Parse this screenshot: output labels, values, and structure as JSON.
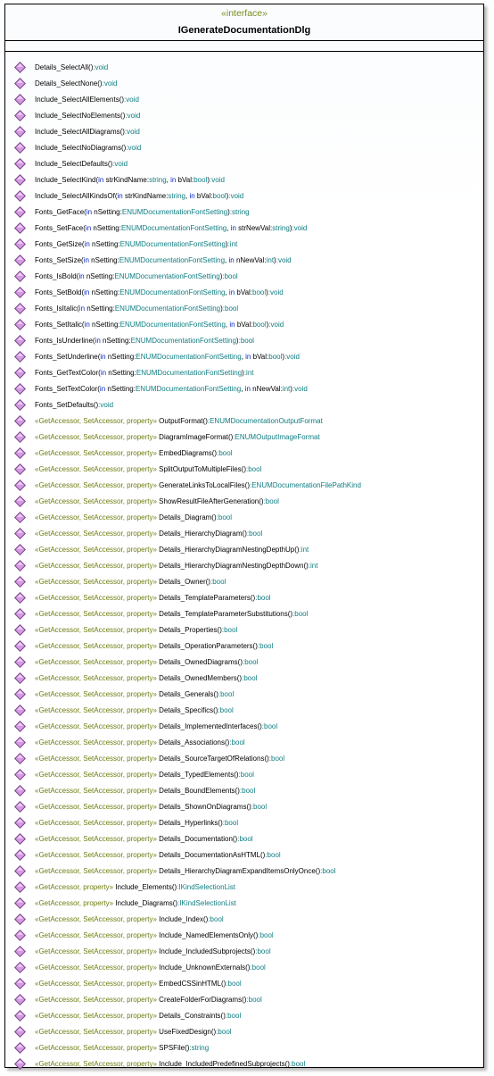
{
  "header": {
    "stereotype": "«interface»",
    "name": "IGenerateDocumentationDlg"
  },
  "colors": {
    "stereotype": "#707c10",
    "keyword": "#0b27c0",
    "type": "#0f7d82",
    "icon_fill": "#d39be0",
    "icon_stroke": "#7a3f8c"
  },
  "icon_name": "operation-diamond-icon",
  "operations": [
    {
      "parts": [
        [
          "t",
          "Details_SelectAll()"
        ],
        [
          "s",
          ":void"
        ]
      ]
    },
    {
      "parts": [
        [
          "t",
          "Details_SelectNone()"
        ],
        [
          "s",
          ":void"
        ]
      ]
    },
    {
      "parts": [
        [
          "t",
          "Include_SelectAllElements()"
        ],
        [
          "s",
          ":void"
        ]
      ]
    },
    {
      "parts": [
        [
          "t",
          "Include_SelectNoElements()"
        ],
        [
          "s",
          ":void"
        ]
      ]
    },
    {
      "parts": [
        [
          "t",
          "Include_SelectAllDiagrams()"
        ],
        [
          "s",
          ":void"
        ]
      ]
    },
    {
      "parts": [
        [
          "t",
          "Include_SelectNoDiagrams()"
        ],
        [
          "s",
          ":void"
        ]
      ]
    },
    {
      "parts": [
        [
          "t",
          "Include_SelectDefaults()"
        ],
        [
          "s",
          ":void"
        ]
      ]
    },
    {
      "parts": [
        [
          "t",
          "Include_SelectKind("
        ],
        [
          "k",
          "in"
        ],
        [
          "t",
          " strKindName:"
        ],
        [
          "s",
          "string"
        ],
        [
          "t",
          ", "
        ],
        [
          "k",
          "in"
        ],
        [
          "t",
          " bVal:"
        ],
        [
          "s",
          "bool"
        ],
        [
          "t",
          ")"
        ],
        [
          "s",
          ":void"
        ]
      ]
    },
    {
      "parts": [
        [
          "t",
          "Include_SelectAllKindsOf("
        ],
        [
          "k",
          "in"
        ],
        [
          "t",
          " strKindName:"
        ],
        [
          "s",
          "string"
        ],
        [
          "t",
          ", "
        ],
        [
          "k",
          "in"
        ],
        [
          "t",
          " bVal:"
        ],
        [
          "s",
          "bool"
        ],
        [
          "t",
          ")"
        ],
        [
          "s",
          ":void"
        ]
      ]
    },
    {
      "parts": [
        [
          "t",
          "Fonts_GetFace("
        ],
        [
          "k",
          "in"
        ],
        [
          "t",
          " nSetting:"
        ],
        [
          "s",
          "ENUMDocumentationFontSetting"
        ],
        [
          "t",
          ")"
        ],
        [
          "s",
          ":string"
        ]
      ]
    },
    {
      "parts": [
        [
          "t",
          "Fonts_SetFace("
        ],
        [
          "k",
          "in"
        ],
        [
          "t",
          " nSetting:"
        ],
        [
          "s",
          "ENUMDocumentationFontSetting"
        ],
        [
          "t",
          ", "
        ],
        [
          "k",
          "in"
        ],
        [
          "t",
          " strNewVal:"
        ],
        [
          "s",
          "string"
        ],
        [
          "t",
          ")"
        ],
        [
          "s",
          ":void"
        ]
      ]
    },
    {
      "parts": [
        [
          "t",
          "Fonts_GetSize("
        ],
        [
          "k",
          "in"
        ],
        [
          "t",
          " nSetting:"
        ],
        [
          "s",
          "ENUMDocumentationFontSetting"
        ],
        [
          "t",
          ")"
        ],
        [
          "s",
          ":int"
        ]
      ]
    },
    {
      "parts": [
        [
          "t",
          "Fonts_SetSize("
        ],
        [
          "k",
          "in"
        ],
        [
          "t",
          " nSetting:"
        ],
        [
          "s",
          "ENUMDocumentationFontSetting"
        ],
        [
          "t",
          ", "
        ],
        [
          "k",
          "in"
        ],
        [
          "t",
          " nNewVal:"
        ],
        [
          "s",
          "int"
        ],
        [
          "t",
          ")"
        ],
        [
          "s",
          ":void"
        ]
      ]
    },
    {
      "parts": [
        [
          "t",
          "Fonts_IsBold("
        ],
        [
          "k",
          "in"
        ],
        [
          "t",
          " nSetting:"
        ],
        [
          "s",
          "ENUMDocumentationFontSetting"
        ],
        [
          "t",
          ")"
        ],
        [
          "s",
          ":bool"
        ]
      ]
    },
    {
      "parts": [
        [
          "t",
          "Fonts_SetBold("
        ],
        [
          "k",
          "in"
        ],
        [
          "t",
          " nSetting:"
        ],
        [
          "s",
          "ENUMDocumentationFontSetting"
        ],
        [
          "t",
          ", "
        ],
        [
          "k",
          "in"
        ],
        [
          "t",
          " bVal:"
        ],
        [
          "s",
          "bool"
        ],
        [
          "t",
          ")"
        ],
        [
          "s",
          ":void"
        ]
      ]
    },
    {
      "parts": [
        [
          "t",
          "Fonts_IsItalic("
        ],
        [
          "k",
          "in"
        ],
        [
          "t",
          " nSetting:"
        ],
        [
          "s",
          "ENUMDocumentationFontSetting"
        ],
        [
          "t",
          ")"
        ],
        [
          "s",
          ":bool"
        ]
      ]
    },
    {
      "parts": [
        [
          "t",
          "Fonts_SetItalic("
        ],
        [
          "k",
          "in"
        ],
        [
          "t",
          " nSetting:"
        ],
        [
          "s",
          "ENUMDocumentationFontSetting"
        ],
        [
          "t",
          ", "
        ],
        [
          "k",
          "in"
        ],
        [
          "t",
          " bVal:"
        ],
        [
          "s",
          "bool"
        ],
        [
          "t",
          ")"
        ],
        [
          "s",
          ":void"
        ]
      ]
    },
    {
      "parts": [
        [
          "t",
          "Fonts_IsUnderline("
        ],
        [
          "k",
          "in"
        ],
        [
          "t",
          " nSetting:"
        ],
        [
          "s",
          "ENUMDocumentationFontSetting"
        ],
        [
          "t",
          ")"
        ],
        [
          "s",
          ":bool"
        ]
      ]
    },
    {
      "parts": [
        [
          "t",
          "Fonts_SetUnderline("
        ],
        [
          "k",
          "in"
        ],
        [
          "t",
          " nSetting:"
        ],
        [
          "s",
          "ENUMDocumentationFontSetting"
        ],
        [
          "t",
          ", "
        ],
        [
          "k",
          "in"
        ],
        [
          "t",
          " bVal:"
        ],
        [
          "s",
          "bool"
        ],
        [
          "t",
          ")"
        ],
        [
          "s",
          ":void"
        ]
      ]
    },
    {
      "parts": [
        [
          "t",
          "Fonts_GetTextColor("
        ],
        [
          "k",
          "in"
        ],
        [
          "t",
          " nSetting:"
        ],
        [
          "s",
          "ENUMDocumentationFontSetting"
        ],
        [
          "t",
          ")"
        ],
        [
          "s",
          ":int"
        ]
      ]
    },
    {
      "parts": [
        [
          "t",
          "Fonts_SetTextColor("
        ],
        [
          "k",
          "in"
        ],
        [
          "t",
          " nSetting:"
        ],
        [
          "s",
          "ENUMDocumentationFontSetting"
        ],
        [
          "t",
          ", "
        ],
        [
          "k",
          "in"
        ],
        [
          "t",
          " nNewVal:"
        ],
        [
          "s",
          "int"
        ],
        [
          "t",
          ")"
        ],
        [
          "s",
          ":void"
        ]
      ]
    },
    {
      "parts": [
        [
          "t",
          "Fonts_SetDefaults()"
        ],
        [
          "s",
          ":void"
        ]
      ]
    },
    {
      "parts": [
        [
          "g",
          "«GetAccessor, SetAccessor, property»"
        ],
        [
          "t",
          " OutputFormat()"
        ],
        [
          "s",
          ":ENUMDocumentationOutputFormat"
        ]
      ]
    },
    {
      "parts": [
        [
          "g",
          "«GetAccessor, SetAccessor, property»"
        ],
        [
          "t",
          " DiagramImageFormat()"
        ],
        [
          "s",
          ":ENUMOutputImageFormat"
        ]
      ]
    },
    {
      "parts": [
        [
          "g",
          "«GetAccessor, SetAccessor, property»"
        ],
        [
          "t",
          " EmbedDiagrams()"
        ],
        [
          "s",
          ":bool"
        ]
      ]
    },
    {
      "parts": [
        [
          "g",
          "«GetAccessor, SetAccessor, property»"
        ],
        [
          "t",
          " SplitOutputToMultipleFiles()"
        ],
        [
          "s",
          ":bool"
        ]
      ]
    },
    {
      "parts": [
        [
          "g",
          "«GetAccessor, SetAccessor, property»"
        ],
        [
          "t",
          " GenerateLinksToLocalFiles()"
        ],
        [
          "s",
          ":ENUMDocumentationFilePathKind"
        ]
      ]
    },
    {
      "parts": [
        [
          "g",
          "«GetAccessor, SetAccessor, property»"
        ],
        [
          "t",
          " ShowResultFileAfterGeneration()"
        ],
        [
          "s",
          ":bool"
        ]
      ]
    },
    {
      "parts": [
        [
          "g",
          "«GetAccessor, SetAccessor, property»"
        ],
        [
          "t",
          " Details_Diagram()"
        ],
        [
          "s",
          ":bool"
        ]
      ]
    },
    {
      "parts": [
        [
          "g",
          "«GetAccessor, SetAccessor, property»"
        ],
        [
          "t",
          " Details_HierarchyDiagram()"
        ],
        [
          "s",
          ":bool"
        ]
      ]
    },
    {
      "parts": [
        [
          "g",
          "«GetAccessor, SetAccessor, property»"
        ],
        [
          "t",
          " Details_HierarchyDiagramNestingDepthUp()"
        ],
        [
          "s",
          ":int"
        ]
      ]
    },
    {
      "parts": [
        [
          "g",
          "«GetAccessor, SetAccessor, property»"
        ],
        [
          "t",
          " Details_HierarchyDiagramNestingDepthDown()"
        ],
        [
          "s",
          ":int"
        ]
      ]
    },
    {
      "parts": [
        [
          "g",
          "«GetAccessor, SetAccessor, property»"
        ],
        [
          "t",
          " Details_Owner()"
        ],
        [
          "s",
          ":bool"
        ]
      ]
    },
    {
      "parts": [
        [
          "g",
          "«GetAccessor, SetAccessor, property»"
        ],
        [
          "t",
          " Details_TemplateParameters()"
        ],
        [
          "s",
          ":bool"
        ]
      ]
    },
    {
      "parts": [
        [
          "g",
          "«GetAccessor, SetAccessor, property»"
        ],
        [
          "t",
          " Details_TemplateParameterSubstitutions()"
        ],
        [
          "s",
          ":bool"
        ]
      ]
    },
    {
      "parts": [
        [
          "g",
          "«GetAccessor, SetAccessor, property»"
        ],
        [
          "t",
          " Details_Properties()"
        ],
        [
          "s",
          ":bool"
        ]
      ]
    },
    {
      "parts": [
        [
          "g",
          "«GetAccessor, SetAccessor, property»"
        ],
        [
          "t",
          " Details_OperationParameters()"
        ],
        [
          "s",
          ":bool"
        ]
      ]
    },
    {
      "parts": [
        [
          "g",
          "«GetAccessor, SetAccessor, property»"
        ],
        [
          "t",
          " Details_OwnedDiagrams()"
        ],
        [
          "s",
          ":bool"
        ]
      ]
    },
    {
      "parts": [
        [
          "g",
          "«GetAccessor, SetAccessor, property»"
        ],
        [
          "t",
          " Details_OwnedMembers()"
        ],
        [
          "s",
          ":bool"
        ]
      ]
    },
    {
      "parts": [
        [
          "g",
          "«GetAccessor, SetAccessor, property»"
        ],
        [
          "t",
          " Details_Generals()"
        ],
        [
          "s",
          ":bool"
        ]
      ]
    },
    {
      "parts": [
        [
          "g",
          "«GetAccessor, SetAccessor, property»"
        ],
        [
          "t",
          " Details_Specifics()"
        ],
        [
          "s",
          ":bool"
        ]
      ]
    },
    {
      "parts": [
        [
          "g",
          "«GetAccessor, SetAccessor, property»"
        ],
        [
          "t",
          " Details_ImplementedInterfaces()"
        ],
        [
          "s",
          ":bool"
        ]
      ]
    },
    {
      "parts": [
        [
          "g",
          "«GetAccessor, SetAccessor, property»"
        ],
        [
          "t",
          " Details_Associations()"
        ],
        [
          "s",
          ":bool"
        ]
      ]
    },
    {
      "parts": [
        [
          "g",
          "«GetAccessor, SetAccessor, property»"
        ],
        [
          "t",
          " Details_SourceTargetOfRelations()"
        ],
        [
          "s",
          ":bool"
        ]
      ]
    },
    {
      "parts": [
        [
          "g",
          "«GetAccessor, SetAccessor, property»"
        ],
        [
          "t",
          " Details_TypedElements()"
        ],
        [
          "s",
          ":bool"
        ]
      ]
    },
    {
      "parts": [
        [
          "g",
          "«GetAccessor, SetAccessor, property»"
        ],
        [
          "t",
          " Details_BoundElements()"
        ],
        [
          "s",
          ":bool"
        ]
      ]
    },
    {
      "parts": [
        [
          "g",
          "«GetAccessor, SetAccessor, property»"
        ],
        [
          "t",
          " Details_ShownOnDiagrams()"
        ],
        [
          "s",
          ":bool"
        ]
      ]
    },
    {
      "parts": [
        [
          "g",
          "«GetAccessor, SetAccessor, property»"
        ],
        [
          "t",
          " Details_Hyperlinks()"
        ],
        [
          "s",
          ":bool"
        ]
      ]
    },
    {
      "parts": [
        [
          "g",
          "«GetAccessor, SetAccessor, property»"
        ],
        [
          "t",
          " Details_Documentation()"
        ],
        [
          "s",
          ":bool"
        ]
      ]
    },
    {
      "parts": [
        [
          "g",
          "«GetAccessor, SetAccessor, property»"
        ],
        [
          "t",
          " Details_DocumentationAsHTML()"
        ],
        [
          "s",
          ":bool"
        ]
      ]
    },
    {
      "parts": [
        [
          "g",
          "«GetAccessor, SetAccessor, property»"
        ],
        [
          "t",
          " Details_HierarchyDiagramExpandItemsOnlyOnce()"
        ],
        [
          "s",
          ":bool"
        ]
      ]
    },
    {
      "parts": [
        [
          "g",
          "«GetAccessor, property»"
        ],
        [
          "t",
          " Include_Elements()"
        ],
        [
          "s",
          ":IKindSelectionList"
        ]
      ]
    },
    {
      "parts": [
        [
          "g",
          "«GetAccessor, property»"
        ],
        [
          "t",
          " Include_Diagrams()"
        ],
        [
          "s",
          ":IKindSelectionList"
        ]
      ]
    },
    {
      "parts": [
        [
          "g",
          "«GetAccessor, SetAccessor, property»"
        ],
        [
          "t",
          " Include_Index()"
        ],
        [
          "s",
          ":bool"
        ]
      ]
    },
    {
      "parts": [
        [
          "g",
          "«GetAccessor, SetAccessor, property»"
        ],
        [
          "t",
          " Include_NamedElementsOnly()"
        ],
        [
          "s",
          ":bool"
        ]
      ]
    },
    {
      "parts": [
        [
          "g",
          "«GetAccessor, SetAccessor, property»"
        ],
        [
          "t",
          " Include_IncludedSubprojects()"
        ],
        [
          "s",
          ":bool"
        ]
      ]
    },
    {
      "parts": [
        [
          "g",
          "«GetAccessor, SetAccessor, property»"
        ],
        [
          "t",
          " Include_UnknownExternals()"
        ],
        [
          "s",
          ":bool"
        ]
      ]
    },
    {
      "parts": [
        [
          "g",
          "«GetAccessor, SetAccessor, property»"
        ],
        [
          "t",
          " EmbedCSSinHTML()"
        ],
        [
          "s",
          ":bool"
        ]
      ]
    },
    {
      "parts": [
        [
          "g",
          "«GetAccessor, SetAccessor, property»"
        ],
        [
          "t",
          " CreateFolderForDiagrams()"
        ],
        [
          "s",
          ":bool"
        ]
      ]
    },
    {
      "parts": [
        [
          "g",
          "«GetAccessor, SetAccessor, property»"
        ],
        [
          "t",
          " Details_Constraints()"
        ],
        [
          "s",
          ":bool"
        ]
      ]
    },
    {
      "parts": [
        [
          "g",
          "«GetAccessor, SetAccessor, property»"
        ],
        [
          "t",
          " UseFixedDesign()"
        ],
        [
          "s",
          ":bool"
        ]
      ]
    },
    {
      "parts": [
        [
          "g",
          "«GetAccessor, SetAccessor, property»"
        ],
        [
          "t",
          " SPSFile()"
        ],
        [
          "s",
          ":string"
        ]
      ]
    },
    {
      "parts": [
        [
          "g",
          "«GetAccessor, SetAccessor, property»"
        ],
        [
          "t",
          " Include_IncludedPredefinedSubprojects()"
        ],
        [
          "s",
          ":bool"
        ]
      ]
    }
  ]
}
